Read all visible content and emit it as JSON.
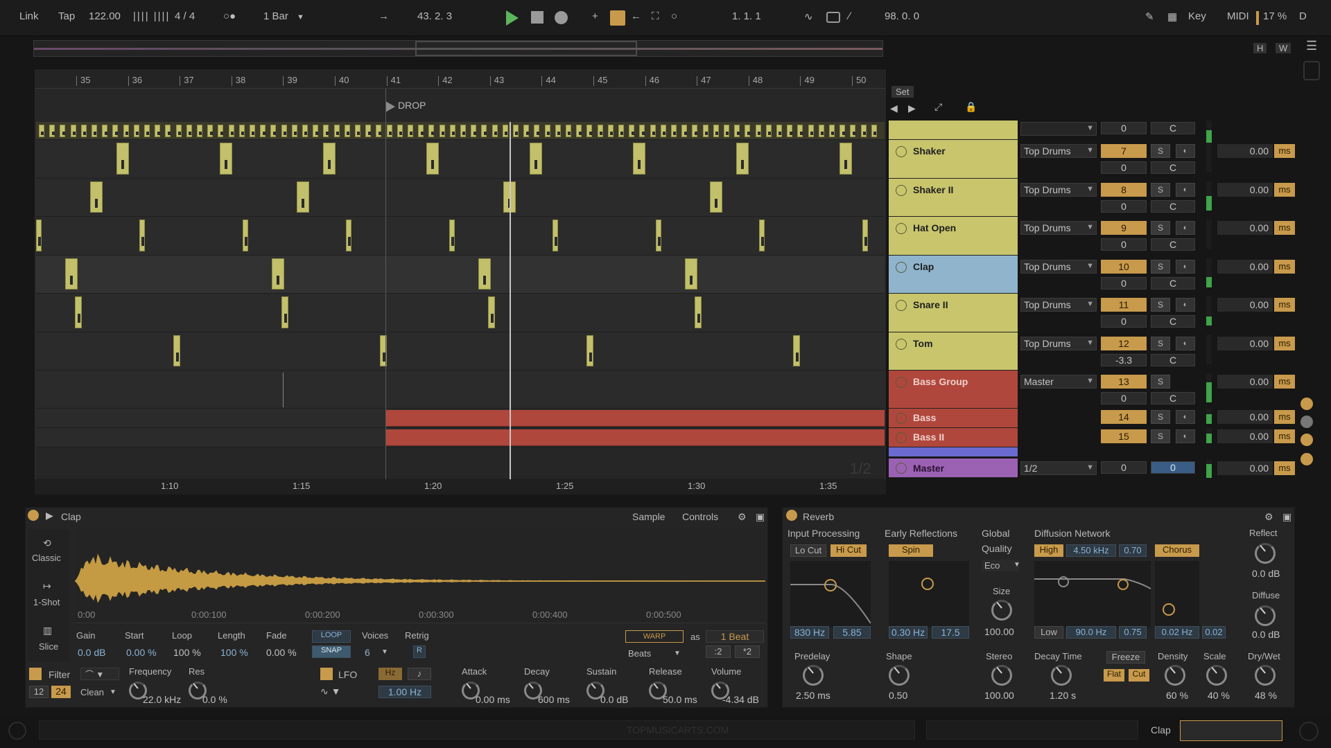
{
  "transport": {
    "link": "Link",
    "tap": "Tap",
    "tempo": "122.00",
    "signature": "4 / 4",
    "quantize": "1 Bar",
    "position": "43.  2.  3",
    "loop_start": "1.  1.  1",
    "loop_length": "98.  0.  0",
    "key": "Key",
    "midi": "MIDI",
    "cpu": "17 %",
    "d": "D"
  },
  "overview": {
    "h": "H",
    "w": "W"
  },
  "ruler": {
    "bars": [
      "35",
      "36",
      "37",
      "38",
      "39",
      "40",
      "41",
      "42",
      "43",
      "44",
      "45",
      "46",
      "47",
      "48",
      "49",
      "50"
    ],
    "times": [
      "1:10",
      "1:15",
      "1:20",
      "1:25",
      "1:30",
      "1:35"
    ],
    "marker": "DROP",
    "set": "Set"
  },
  "tracks": [
    {
      "name": "Shaker",
      "route": "Top Drums",
      "num": "7",
      "vol": "0",
      "pan": "C",
      "delay": "0.00",
      "unit": "ms",
      "color": "#c8c56d",
      "meter": 0.0
    },
    {
      "name": "Shaker II",
      "route": "Top Drums",
      "num": "8",
      "vol": "0",
      "pan": "C",
      "delay": "0.00",
      "unit": "ms",
      "color": "#c8c56d",
      "meter": 0.5
    },
    {
      "name": "Hat Open",
      "route": "Top Drums",
      "num": "9",
      "vol": "0",
      "pan": "C",
      "delay": "0.00",
      "unit": "ms",
      "color": "#c8c56d",
      "meter": 0.0
    },
    {
      "name": "Clap",
      "route": "Top Drums",
      "num": "10",
      "vol": "0",
      "pan": "C",
      "delay": "0.00",
      "unit": "ms",
      "color": "#8fb4cc",
      "meter": 0.35
    },
    {
      "name": "Snare II",
      "route": "Top Drums",
      "num": "11",
      "vol": "0",
      "pan": "C",
      "delay": "0.00",
      "unit": "ms",
      "color": "#c8c56d",
      "meter": 0.3
    },
    {
      "name": "Tom",
      "route": "Top Drums",
      "num": "12",
      "vol": "-3.3",
      "pan": "C",
      "delay": "0.00",
      "unit": "ms",
      "color": "#c8c56d",
      "meter": 0.0
    },
    {
      "name": "Bass Group",
      "route": "Master",
      "num": "13",
      "vol": "0",
      "pan": "C",
      "delay": "0.00",
      "unit": "ms",
      "color": "#b0473c",
      "meter": 0.7
    }
  ],
  "small_tracks": [
    {
      "name": "Bass",
      "num": "14",
      "delay": "0.00",
      "unit": "ms"
    },
    {
      "name": "Bass II",
      "num": "15",
      "delay": "0.00",
      "unit": "ms"
    }
  ],
  "top_track": {
    "vol": "0",
    "pan": "C"
  },
  "master": {
    "name": "Master",
    "route": "1/2",
    "vol": "0",
    "pan": "0",
    "delay": "0.00",
    "unit": "ms",
    "half": "1/2"
  },
  "solo_label": "S",
  "sampler": {
    "title": "Clap",
    "tab_sample": "Sample",
    "tab_controls": "Controls",
    "modes": [
      "Classic",
      "1-Shot",
      "Slice"
    ],
    "times": [
      "0:00",
      "0:00:100",
      "0:00:200",
      "0:00:300",
      "0:00:400",
      "0:00:500"
    ],
    "gain_l": "Gain",
    "gain": "0.0 dB",
    "start_l": "Start",
    "start": "0.00 %",
    "loop_l": "Loop",
    "loop": "100 %",
    "length_l": "Length",
    "length": "100 %",
    "fade_l": "Fade",
    "fade": "0.00 %",
    "loop_btn": "LOOP",
    "snap_btn": "SNAP",
    "voices_l": "Voices",
    "voices": "6",
    "retrig_l": "Retrig",
    "retrig": "R",
    "warp": "WARP",
    "as": "as",
    "beat": "1 Beat",
    "beats": "Beats",
    "div": ":2",
    "mul": "*2",
    "filter": "Filter",
    "freq_l": "Frequency",
    "freq": "22.0 kHz",
    "res_l": "Res",
    "res": "0.0 %",
    "slope_12": "12",
    "slope_24": "24",
    "clean": "Clean",
    "lfo": "LFO",
    "hz": "Hz",
    "lfo_rate": "1.00 Hz",
    "attack_l": "Attack",
    "attack": "0.00 ms",
    "decay_l": "Decay",
    "decay": "600 ms",
    "sustain_l": "Sustain",
    "sustain": "0.0 dB",
    "release_l": "Release",
    "release": "50.0 ms",
    "volume_l": "Volume",
    "volume": "-4.34 dB"
  },
  "reverb": {
    "title": "Reverb",
    "input": "Input Processing",
    "lo_cut": "Lo Cut",
    "hi_cut": "Hi Cut",
    "early": "Early Reflections",
    "spin": "Spin",
    "global": "Global",
    "quality": "Quality",
    "eco": "Eco",
    "size_l": "Size",
    "size": "100.00",
    "diffnet": "Diffusion Network",
    "high": "High",
    "high_freq": "4.50 kHz",
    "high_val": "0.70",
    "chorus": "Chorus",
    "reflect_l": "Reflect",
    "reflect": "0.0 dB",
    "diffuse_l": "Diffuse",
    "diffuse": "0.0 dB",
    "in_freq": "830 Hz",
    "in_q": "5.85",
    "er_freq": "0.30 Hz",
    "er_val": "17.5",
    "low": "Low",
    "low_freq": "90.0 Hz",
    "low_val": "0.75",
    "ch_freq": "0.02 Hz",
    "ch_val": "0.02",
    "predelay_l": "Predelay",
    "predelay": "2.50 ms",
    "shape_l": "Shape",
    "shape": "0.50",
    "stereo_l": "Stereo",
    "stereo": "100.00",
    "decay_l": "Decay Time",
    "decay": "1.20 s",
    "freeze": "Freeze",
    "flat": "Flat",
    "cut": "Cut",
    "density_l": "Density",
    "density": "60 %",
    "scale_l": "Scale",
    "scale": "40 %",
    "drywet_l": "Dry/Wet",
    "drywet": "48 %"
  },
  "status": {
    "watermark": "TOPMUSICARTS.COM",
    "clip": "Clap"
  }
}
